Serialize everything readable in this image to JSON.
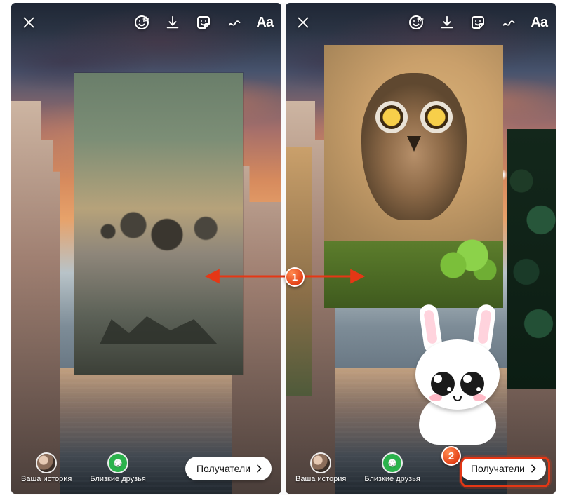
{
  "toolbar": {
    "close_label": "Close",
    "face_filter_label": "Face filter",
    "save_label": "Save",
    "sticker_label": "Stickers",
    "draw_label": "Draw",
    "text_tool_label": "Aa"
  },
  "bottom": {
    "your_story_label": "Ваша история",
    "close_friends_label": "Близкие друзья",
    "recipients_label": "Получатели"
  },
  "annotations": {
    "step1": "1",
    "step2": "2"
  },
  "left_screen": {
    "inserted_media": "painting-of-old-town"
  },
  "right_screen": {
    "media_owl": "owl-on-moss",
    "media_leaves": "green-leaves",
    "sticker": "bunny-sticker"
  }
}
